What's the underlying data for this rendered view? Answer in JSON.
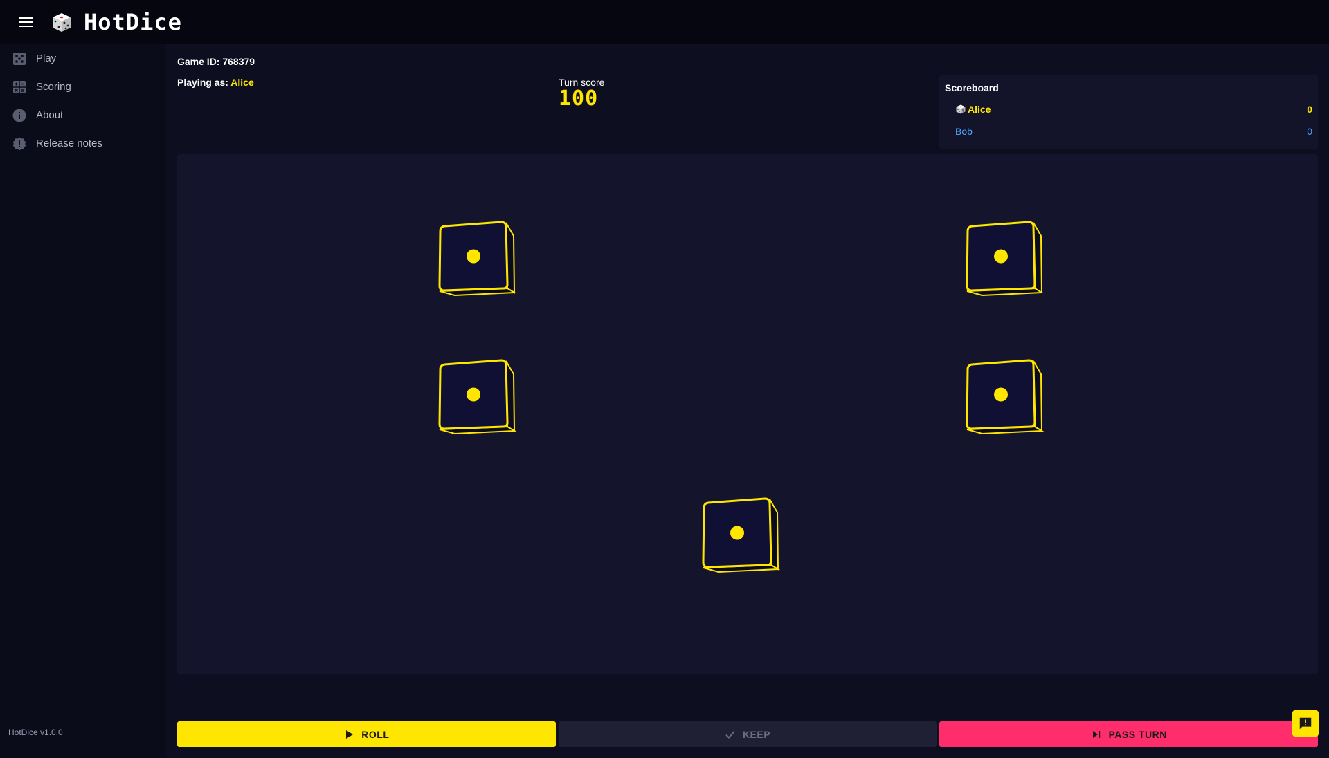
{
  "app": {
    "title": "HotDice",
    "version": "HotDice v1.0.0",
    "colors": {
      "accent": "#ffe600",
      "danger": "#ff2d6b",
      "secondary": "#4aa8ff",
      "background": "#0d0e1f"
    }
  },
  "sidebar": {
    "items": [
      {
        "label": "Play",
        "icon": "dice-icon"
      },
      {
        "label": "Scoring",
        "icon": "scoring-icon"
      },
      {
        "label": "About",
        "icon": "info-icon"
      },
      {
        "label": "Release notes",
        "icon": "release-notes-icon"
      }
    ]
  },
  "game": {
    "id_label": "Game ID: 768379",
    "playing_as_label": "Playing as:",
    "player_name": "Alice",
    "turn_score_label": "Turn score",
    "turn_score": "100"
  },
  "scoreboard": {
    "title": "Scoreboard",
    "players": [
      {
        "name": "Alice",
        "score": "0",
        "active": true
      },
      {
        "name": "Bob",
        "score": "0",
        "active": false
      }
    ]
  },
  "dice": [
    {
      "value": 1
    },
    {
      "value": 1
    },
    {
      "value": 1
    },
    {
      "value": 1
    },
    {
      "value": 1
    }
  ],
  "actions": {
    "roll": "ROLL",
    "keep": "KEEP",
    "pass": "PASS TURN"
  }
}
